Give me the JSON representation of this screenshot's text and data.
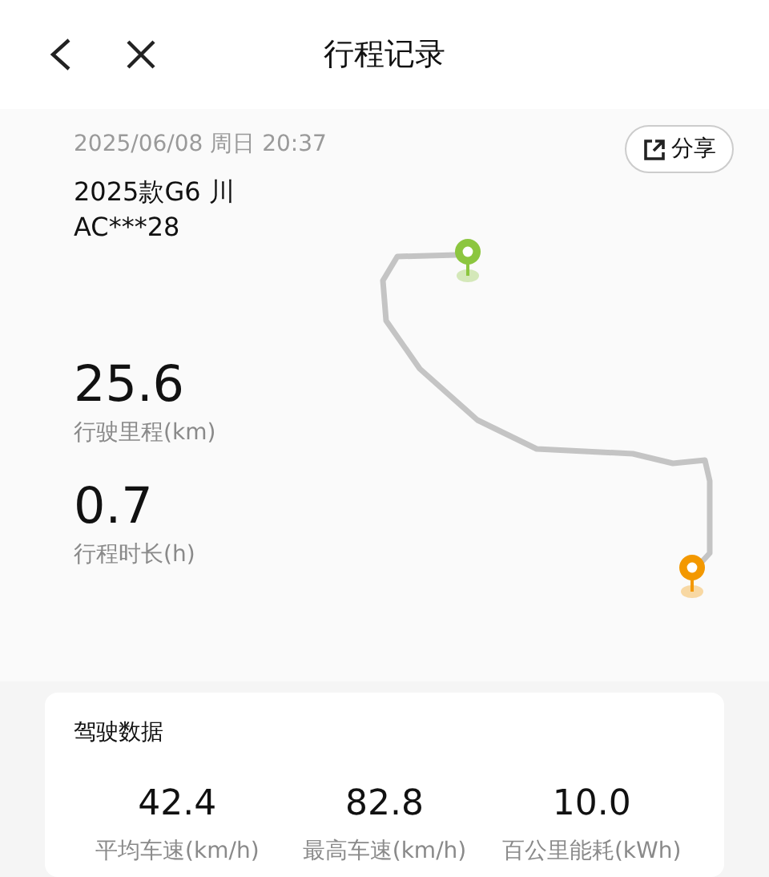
{
  "header": {
    "title": "行程记录"
  },
  "trip": {
    "datetime": "2025/06/08 周日 20:37",
    "vehicle": "2025款G6 川",
    "plate": "AC***28",
    "share": "分享"
  },
  "summary": [
    {
      "value": "25.6",
      "label": "行驶里程(km)"
    },
    {
      "value": "0.7",
      "label": "行程时长(h)"
    }
  ],
  "map": {
    "markers": [
      {
        "kind": "start",
        "color": "#8cc63f"
      },
      {
        "kind": "end",
        "color": "#f39800"
      }
    ]
  },
  "driving_data": {
    "title": "驾驶数据",
    "stats": [
      {
        "value": "42.4",
        "label": "平均车速(km/h)"
      },
      {
        "value": "82.8",
        "label": "最高车速(km/h)"
      },
      {
        "value": "10.0",
        "label": "百公里能耗(kWh)"
      }
    ]
  }
}
